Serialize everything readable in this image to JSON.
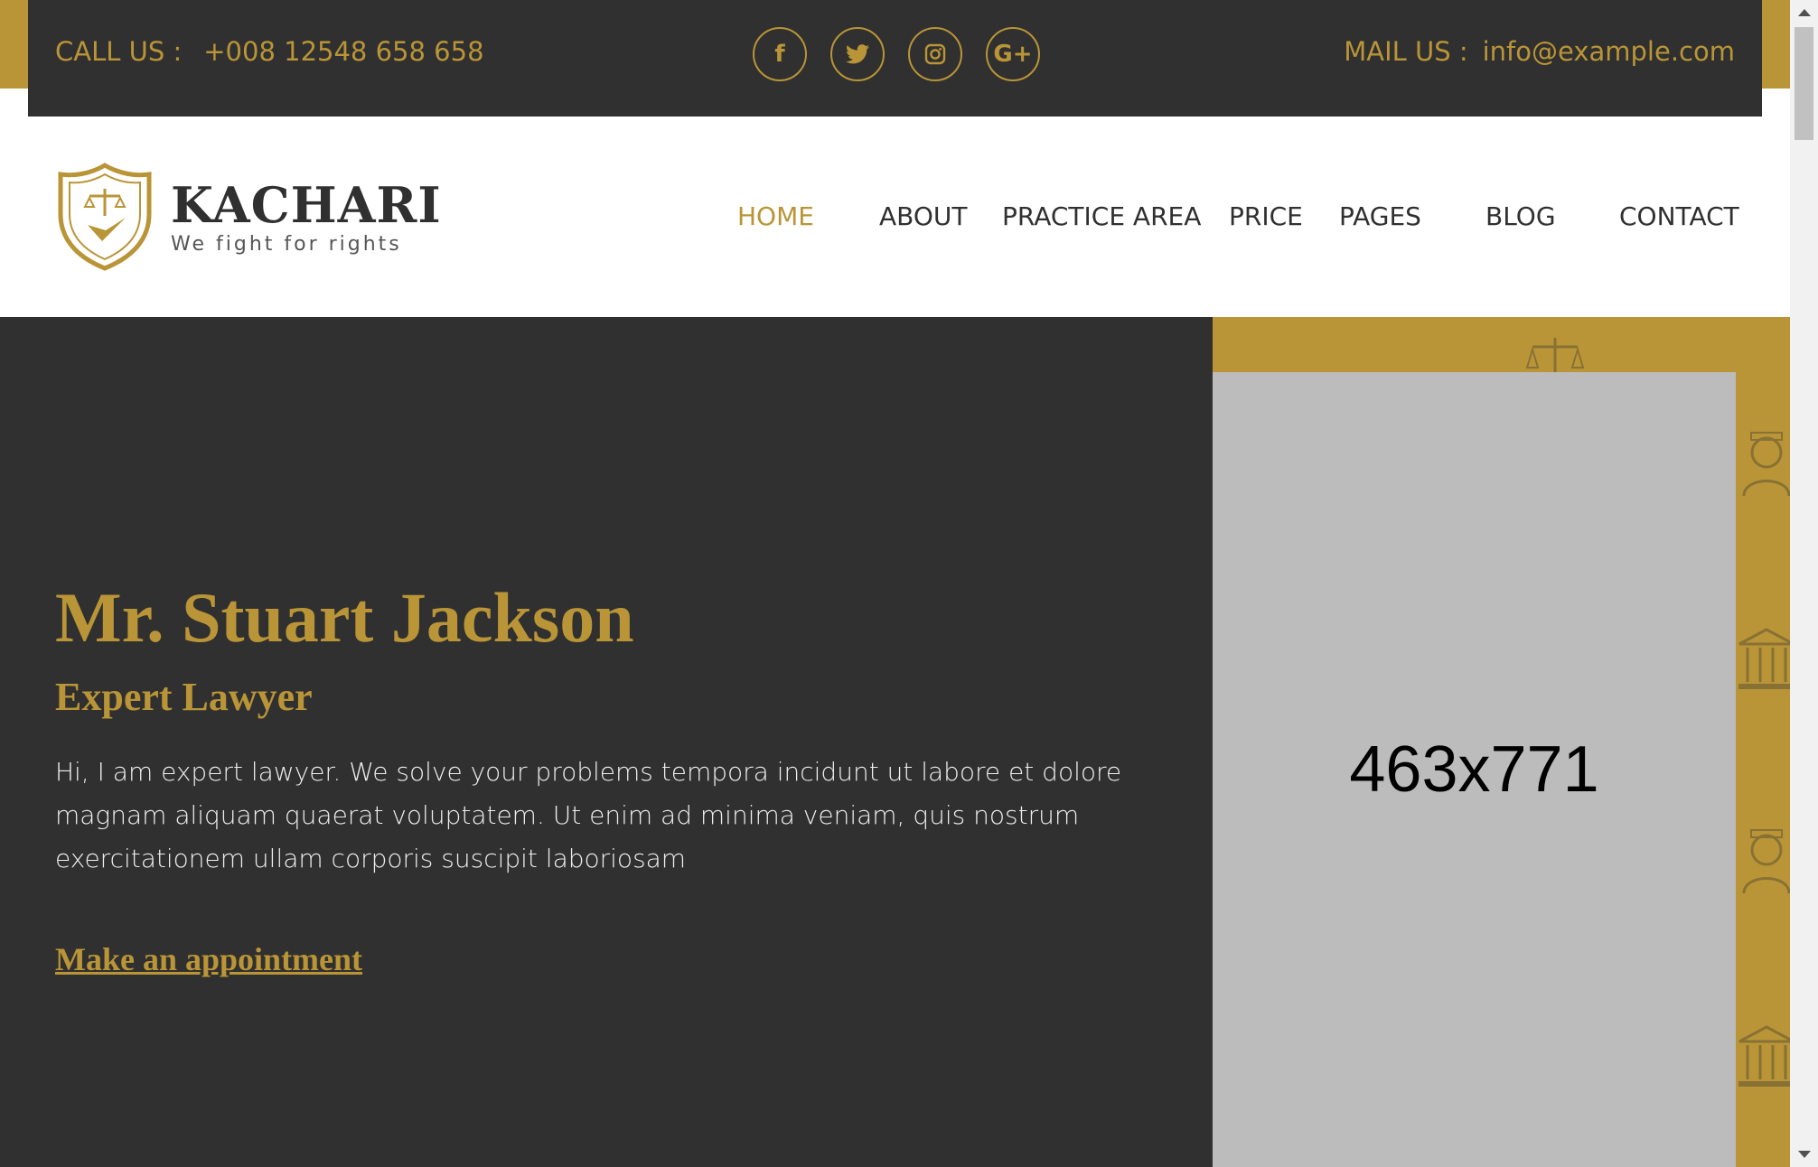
{
  "topbar": {
    "call_label": "CALL US :",
    "call_number": "+008 12548 658 658",
    "mail_label": "MAIL US :",
    "mail_address": "info@example.com",
    "social": [
      {
        "icon": "facebook-icon",
        "glyph": "f"
      },
      {
        "icon": "twitter-icon",
        "glyph": "t"
      },
      {
        "icon": "instagram-icon",
        "glyph": "i"
      },
      {
        "icon": "google-plus-icon",
        "glyph": "G+"
      }
    ]
  },
  "header": {
    "logo_name": "KACHARI",
    "logo_tagline": "We fight for rights",
    "nav": [
      {
        "label": "HOME",
        "active": true
      },
      {
        "label": "ABOUT",
        "active": false
      },
      {
        "label": "PRACTICE AREA",
        "active": false
      },
      {
        "label": "PRICE",
        "active": false
      },
      {
        "label": "PAGES",
        "active": false
      },
      {
        "label": "BLOG",
        "active": false
      },
      {
        "label": "CONTACT",
        "active": false
      }
    ]
  },
  "hero": {
    "title": "Mr. Stuart Jackson",
    "subtitle": "Expert Lawyer",
    "text": "Hi, I am expert lawyer. We solve your problems tempora incidunt ut labore et dolore magnam aliquam quaerat voluptatem. Ut enim ad minima veniam, quis nostrum exercitationem ullam corporis suscipit laboriosam",
    "link_label": "Make an appointment",
    "image_placeholder": "463x771"
  },
  "colors": {
    "accent": "#b99537",
    "dark": "#303030",
    "placeholder_bg": "#bcbcbc"
  }
}
